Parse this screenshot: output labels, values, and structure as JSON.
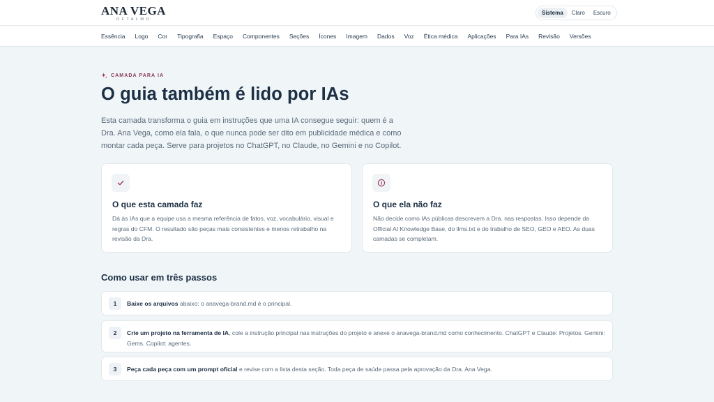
{
  "brand": {
    "name": "Ana Vega",
    "subtitle": "OFTALMO"
  },
  "theme": {
    "options": [
      "Sistema",
      "Claro",
      "Escuro"
    ],
    "selected": "Sistema"
  },
  "nav": {
    "items": [
      "Essência",
      "Logo",
      "Cor",
      "Tipografia",
      "Espaço",
      "Componentes",
      "Seções",
      "Ícones",
      "Imagem",
      "Dados",
      "Voz",
      "Ética médica",
      "Aplicações",
      "Para IAs",
      "Revisão",
      "Versões"
    ]
  },
  "hero": {
    "eyebrow": "CAMADA PARA IA",
    "title": "O guia também é lido por IAs",
    "lead": "Esta camada transforma o guia em instruções que uma IA consegue seguir: quem é a Dra. Ana Vega, como ela fala, o que nunca pode ser dito em publicidade médica e como montar cada peça. Serve para projetos no ChatGPT, no Claude, no Gemini e no Copilot."
  },
  "cards": [
    {
      "icon": "check-icon",
      "title": "O que esta camada faz",
      "text": "Dá às IAs que a equipe usa a mesma referência de fatos, voz, vocabulário, visual e regras do CFM. O resultado são peças mais consistentes e menos retrabalho na revisão da Dra."
    },
    {
      "icon": "info-icon",
      "title": "O que ela não faz",
      "text": "Não decide como IAs públicas descrevem a Dra. nas respostas. Isso depende da Official AI Knowledge Base, do llms.txt e do trabalho de SEO, GEO e AEO. As duas camadas se completam."
    }
  ],
  "steps": {
    "title": "Como usar em três passos",
    "items": [
      {
        "num": "1",
        "strong": "Baixe os arquivos",
        "rest": " abaixo: o anavega-brand.md é o principal."
      },
      {
        "num": "2",
        "strong": "Crie um projeto na ferramenta de IA",
        "rest": ", cole a instrução principal nas instruções do projeto e anexe o anavega-brand.md como conhecimento. ChatGPT e Claude: Projetos. Gemini: Gems. Copilot: agentes."
      },
      {
        "num": "3",
        "strong": "Peça cada peça com um prompt oficial",
        "rest": " e revise com a lista desta seção. Toda peça de saúde passa pela aprovação da Dra. Ana Vega."
      }
    ]
  },
  "colors": {
    "accent": "#8a3554",
    "heading": "#1c2f44",
    "background": "#f0f5f8"
  }
}
